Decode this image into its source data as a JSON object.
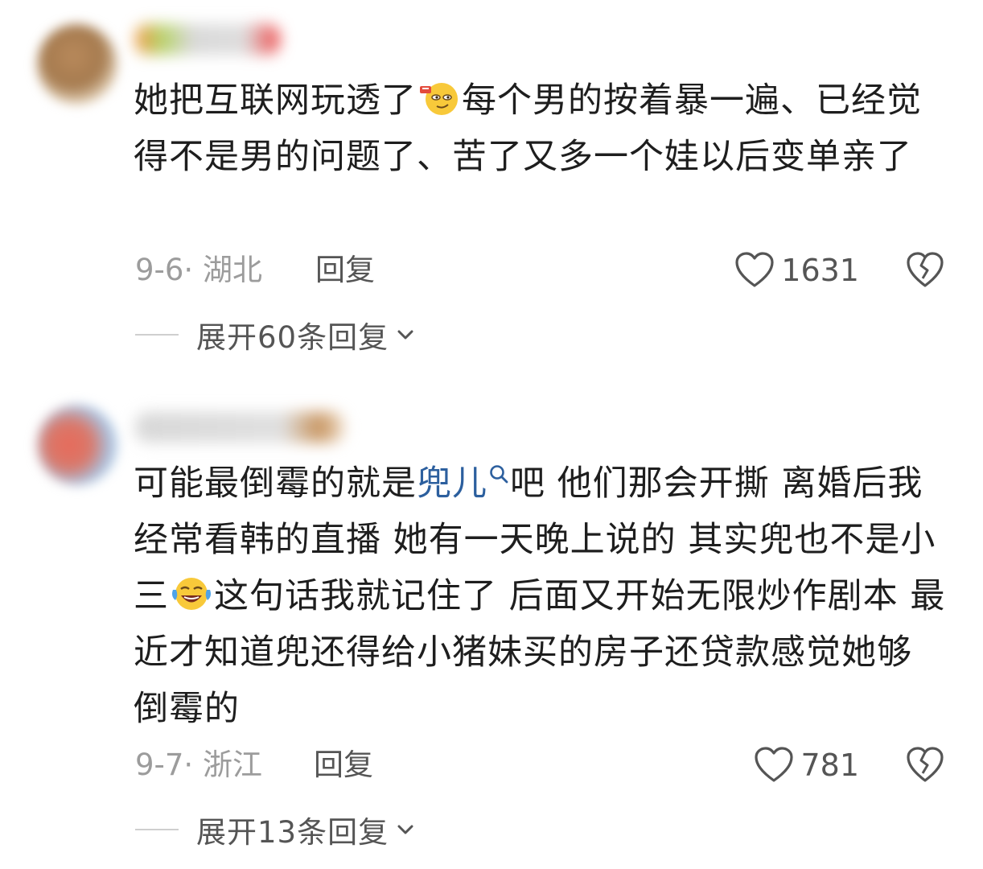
{
  "comments": [
    {
      "body_parts": {
        "before_emoji": "她把互联网玩透了",
        "after_emoji": "每个男的按着暴一遍、已经觉得不是男的问题了、苦了又多一个娃以后变单亲了"
      },
      "emoji_icon": "smirk-face-emoji-icon",
      "date_location": "9-6· 湖北",
      "reply_label": "回复",
      "like_count": "1631",
      "expand_label": "展开60条回复"
    },
    {
      "body_parts": {
        "before_link": "可能最倒霉的就是",
        "link_text": "兜儿",
        "after_link_before_emoji": "吧 他们那会开撕 离婚后我经常看韩的直播 她有一天晚上说的 其实兜也不是小三",
        "after_emoji": "这句话我就记住了 后面又开始无限炒作剧本 最近才知道兜还得给小猪妹买的房子还贷款感觉她够倒霉的"
      },
      "emoji_icon": "laughing-crying-face-emoji-icon",
      "date_location": "9-7· 浙江",
      "reply_label": "回复",
      "like_count": "781",
      "expand_label": "展开13条回复"
    }
  ],
  "colors": {
    "text": "#1e1e1e",
    "meta": "#9c9c9c",
    "secondary": "#555555",
    "link": "#2c5f9e"
  }
}
